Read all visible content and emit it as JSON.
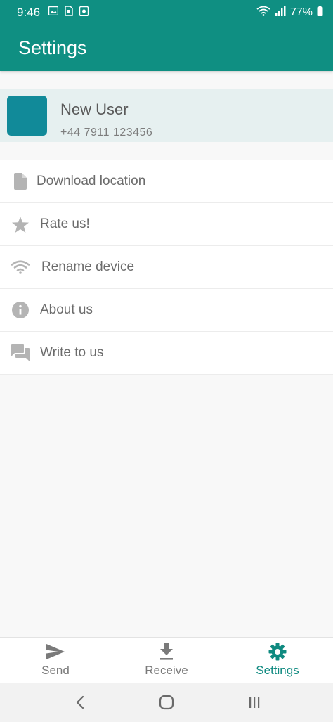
{
  "status_bar": {
    "time": "9:46",
    "battery": "77%",
    "left_icons": [
      "image-icon",
      "sim-icon",
      "screen-record-icon"
    ],
    "right_icons": [
      "wifi-icon",
      "signal-icon",
      "battery-icon"
    ]
  },
  "app_bar": {
    "title": "Settings",
    "color": "#0f8f82"
  },
  "profile": {
    "name": "New User",
    "phone": "+44 7911 123456",
    "avatar_color": "#118a99"
  },
  "menu": {
    "items": [
      {
        "label": "Download location",
        "icon": "file-icon"
      },
      {
        "label": "Rate us!",
        "icon": "star-icon"
      },
      {
        "label": "Rename device",
        "icon": "wifi-icon"
      },
      {
        "label": "About us",
        "icon": "info-icon"
      },
      {
        "label": "Write to us",
        "icon": "chat-icon"
      }
    ]
  },
  "bottom_nav": {
    "items": [
      {
        "label": "Send",
        "icon": "send-icon",
        "active": false
      },
      {
        "label": "Receive",
        "icon": "download-icon",
        "active": false
      },
      {
        "label": "Settings",
        "icon": "gear-icon",
        "active": true
      }
    ],
    "active_color": "#0f8a80"
  },
  "system_nav": {
    "buttons": [
      "back-icon",
      "home-icon",
      "recents-icon"
    ]
  }
}
